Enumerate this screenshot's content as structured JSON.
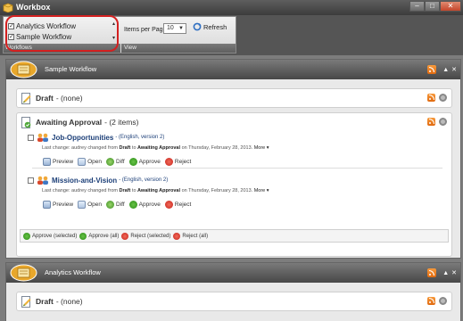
{
  "window": {
    "title": "Workbox",
    "controls": [
      "minimize",
      "maximize",
      "close"
    ]
  },
  "ribbon": {
    "workflows": [
      {
        "label": "Analytics Workflow",
        "checked": true
      },
      {
        "label": "Sample Workflow",
        "checked": true
      }
    ],
    "workflows_group_label": "Workflows",
    "items_per_page_label": "Items per Page:",
    "items_per_page_value": "10",
    "refresh_label": "Refresh",
    "view_group_label": "View"
  },
  "panels": [
    {
      "title": "Sample Workflow",
      "sections": [
        {
          "title": "Draft",
          "subtitle": "- (none)"
        },
        {
          "title": "Awaiting Approval",
          "subtitle": "- (2 items)",
          "items": [
            {
              "title": "Job-Opportunities",
              "meta": "- (English, version 2)",
              "change_prefix": "Last change: audrey changed from",
              "from": "Draft",
              "to_word": "to",
              "to": "Awaiting Approval",
              "change_suffix": "on Thursday, February 28, 2013.",
              "more": "More ▾"
            },
            {
              "title": "Mission-and-Vision",
              "meta": "- (English, version 2)",
              "change_prefix": "Last change: audrey changed from",
              "from": "Draft",
              "to_word": "to",
              "to": "Awaiting Approval",
              "change_suffix": "on Thursday, February 28, 2013.",
              "more": "More ▾"
            }
          ],
          "item_actions": [
            "Preview",
            "Open",
            "Diff",
            "Approve",
            "Reject"
          ],
          "bulk_actions": [
            "Approve (selected)",
            "Approve (all)",
            "Reject (selected)",
            "Reject (all)"
          ]
        }
      ]
    },
    {
      "title": "Analytics Workflow",
      "sections": [
        {
          "title": "Draft",
          "subtitle": "- (none)"
        }
      ]
    }
  ],
  "colors": {
    "accent_link": "#1c3f78",
    "highlight_oval": "#d42020",
    "rss": "#f07c1e"
  }
}
